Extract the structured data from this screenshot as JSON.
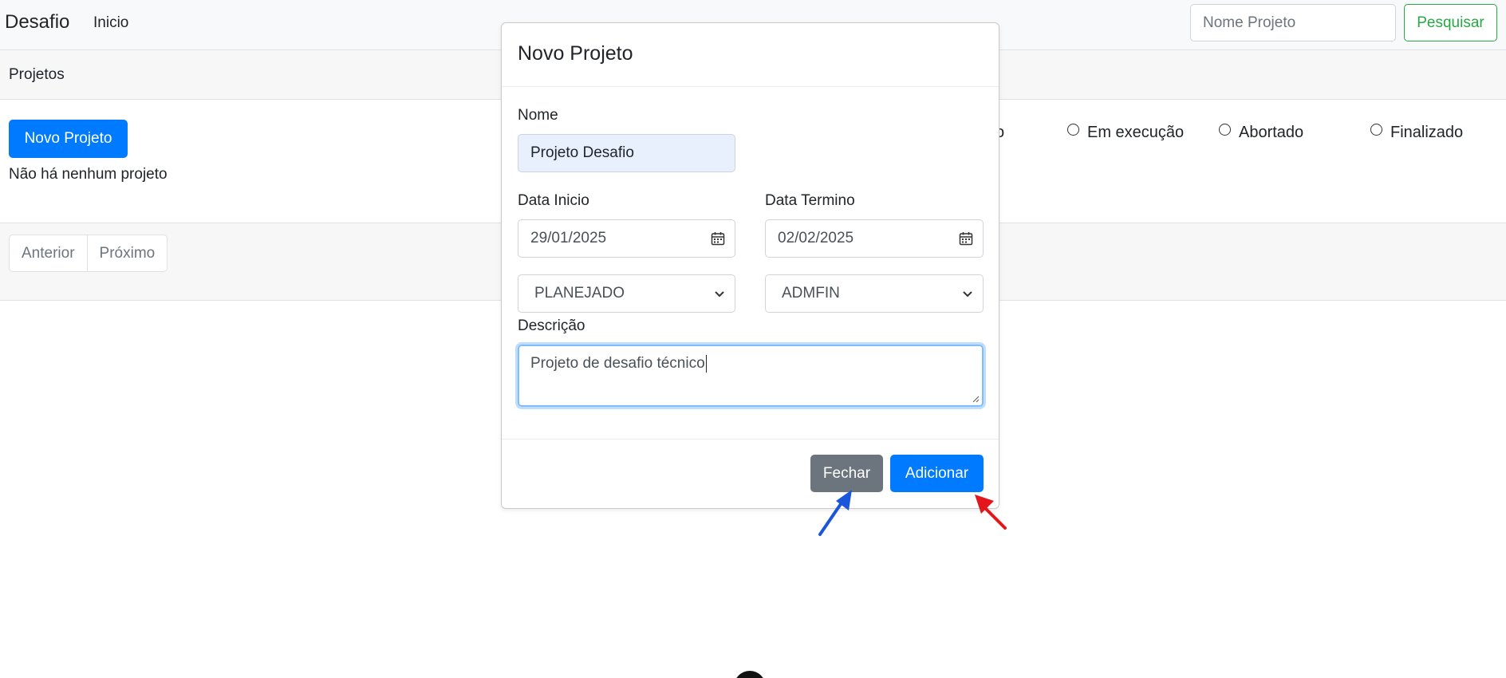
{
  "navbar": {
    "brand": "Desafio",
    "nav_link": "Inicio",
    "search_placeholder": "Nome Projeto",
    "search_button": "Pesquisar"
  },
  "page": {
    "section_title": "Projetos",
    "new_project_button": "Novo Projeto",
    "empty_message": "Não há nenhum projeto",
    "status_filter": {
      "partial_label": "o",
      "options": [
        "Em execução",
        "Abortado",
        "Finalizado"
      ]
    },
    "pagination": {
      "previous": "Anterior",
      "next": "Próximo"
    }
  },
  "modal": {
    "title": "Novo Projeto",
    "name_label": "Nome",
    "name_value": "Projeto Desafio",
    "start_date_label": "Data Inicio",
    "start_date_value": "29/01/2025",
    "end_date_label": "Data Termino",
    "end_date_value": "02/02/2025",
    "status_select_value": "PLANEJADO",
    "manager_select_value": "ADMFIN",
    "description_label": "Descrição",
    "description_value": "Projeto de desafio técnico",
    "close_button": "Fechar",
    "add_button": "Adicionar"
  },
  "colors": {
    "primary": "#007bff",
    "secondary": "#6c757d",
    "success": "#28a745",
    "arrow_blue": "#1a56db",
    "arrow_red": "#e3161b"
  }
}
